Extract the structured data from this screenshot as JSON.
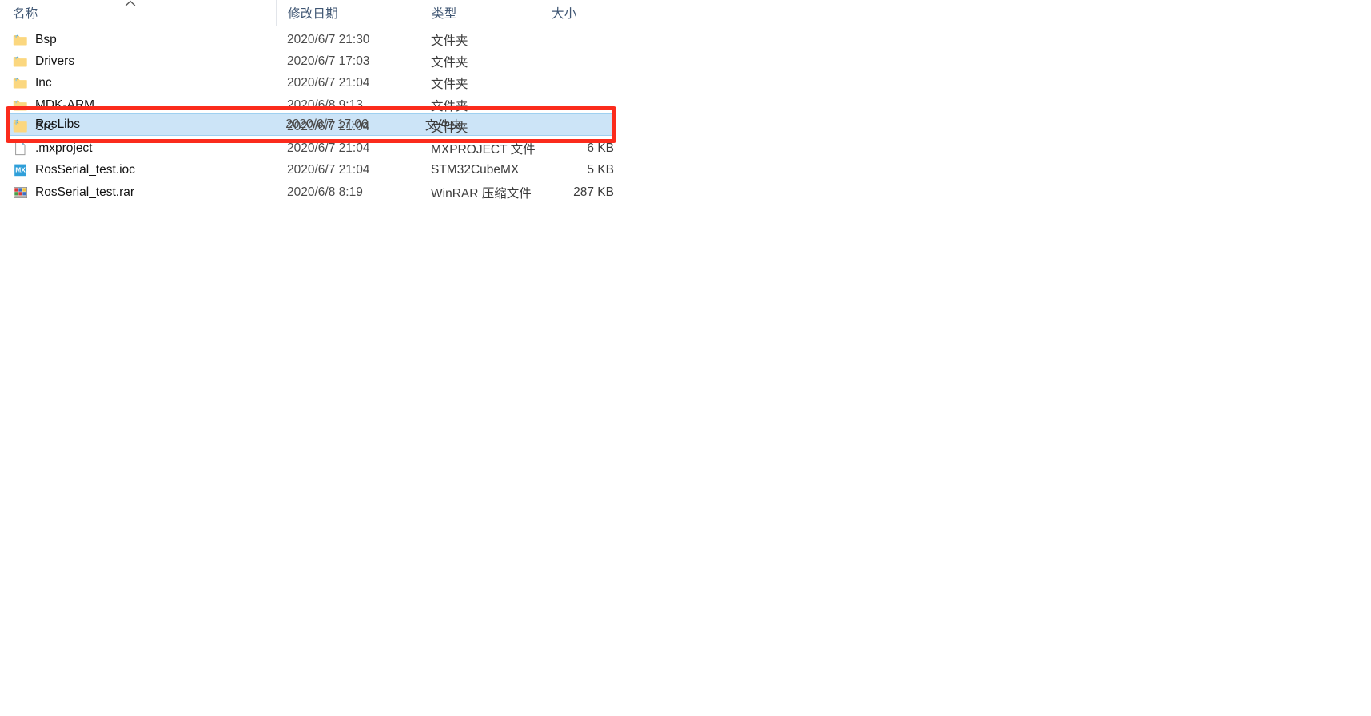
{
  "window": {
    "view": "details-list"
  },
  "columns": [
    {
      "key": "name",
      "label": "名称",
      "sorted": true,
      "sort_direction": "ascending"
    },
    {
      "key": "date",
      "label": "修改日期"
    },
    {
      "key": "type",
      "label": "类型"
    },
    {
      "key": "size",
      "label": "大小"
    }
  ],
  "column_labels": {
    "name": "名称",
    "date": "修改日期",
    "type": "类型",
    "size": "大小"
  },
  "items": [
    {
      "name": "Bsp",
      "date": "2020/6/7 21:30",
      "type": "文件夹",
      "size": "",
      "icon": "folder-icon",
      "selected": false
    },
    {
      "name": "Drivers",
      "date": "2020/6/7 17:03",
      "type": "文件夹",
      "size": "",
      "icon": "folder-icon",
      "selected": false
    },
    {
      "name": "Inc",
      "date": "2020/6/7 21:04",
      "type": "文件夹",
      "size": "",
      "icon": "folder-icon",
      "selected": false
    },
    {
      "name": "MDK-ARM",
      "date": "2020/6/8 9:13",
      "type": "文件夹",
      "size": "",
      "icon": "folder-icon",
      "selected": false
    },
    {
      "name": "RosLibs",
      "date": "2020/6/7 17:06",
      "type": "文件夹",
      "size": "",
      "icon": "folder-icon",
      "selected": true
    },
    {
      "name": "Src",
      "date": "2020/6/7 21:04",
      "type": "文件夹",
      "size": "",
      "icon": "folder-icon",
      "selected": false
    },
    {
      "name": ".mxproject",
      "date": "2020/6/7 21:04",
      "type": "MXPROJECT 文件",
      "size": "6 KB",
      "icon": "generic-file-icon",
      "selected": false
    },
    {
      "name": "RosSerial_test.ioc",
      "date": "2020/6/7 21:04",
      "type": "STM32CubeMX",
      "size": "5 KB",
      "icon": "cubemx-file-icon",
      "selected": false
    },
    {
      "name": "RosSerial_test.rar",
      "date": "2020/6/8 8:19",
      "type": "WinRAR 压缩文件",
      "size": "287 KB",
      "icon": "winrar-file-icon",
      "selected": false
    }
  ],
  "annotation": {
    "shape": "rectangle",
    "color": "#fb2b1c",
    "targets": "RosLibs"
  },
  "colors": {
    "selection_fill": "#cce4f7",
    "selection_border": "#9fd0f0",
    "header_text": "#3f5673",
    "annotation": "#fb2b1c",
    "folder_body": "#fbd77f",
    "folder_tab": "#f9cd62",
    "cubemx_blue": "#2f9fd9"
  }
}
